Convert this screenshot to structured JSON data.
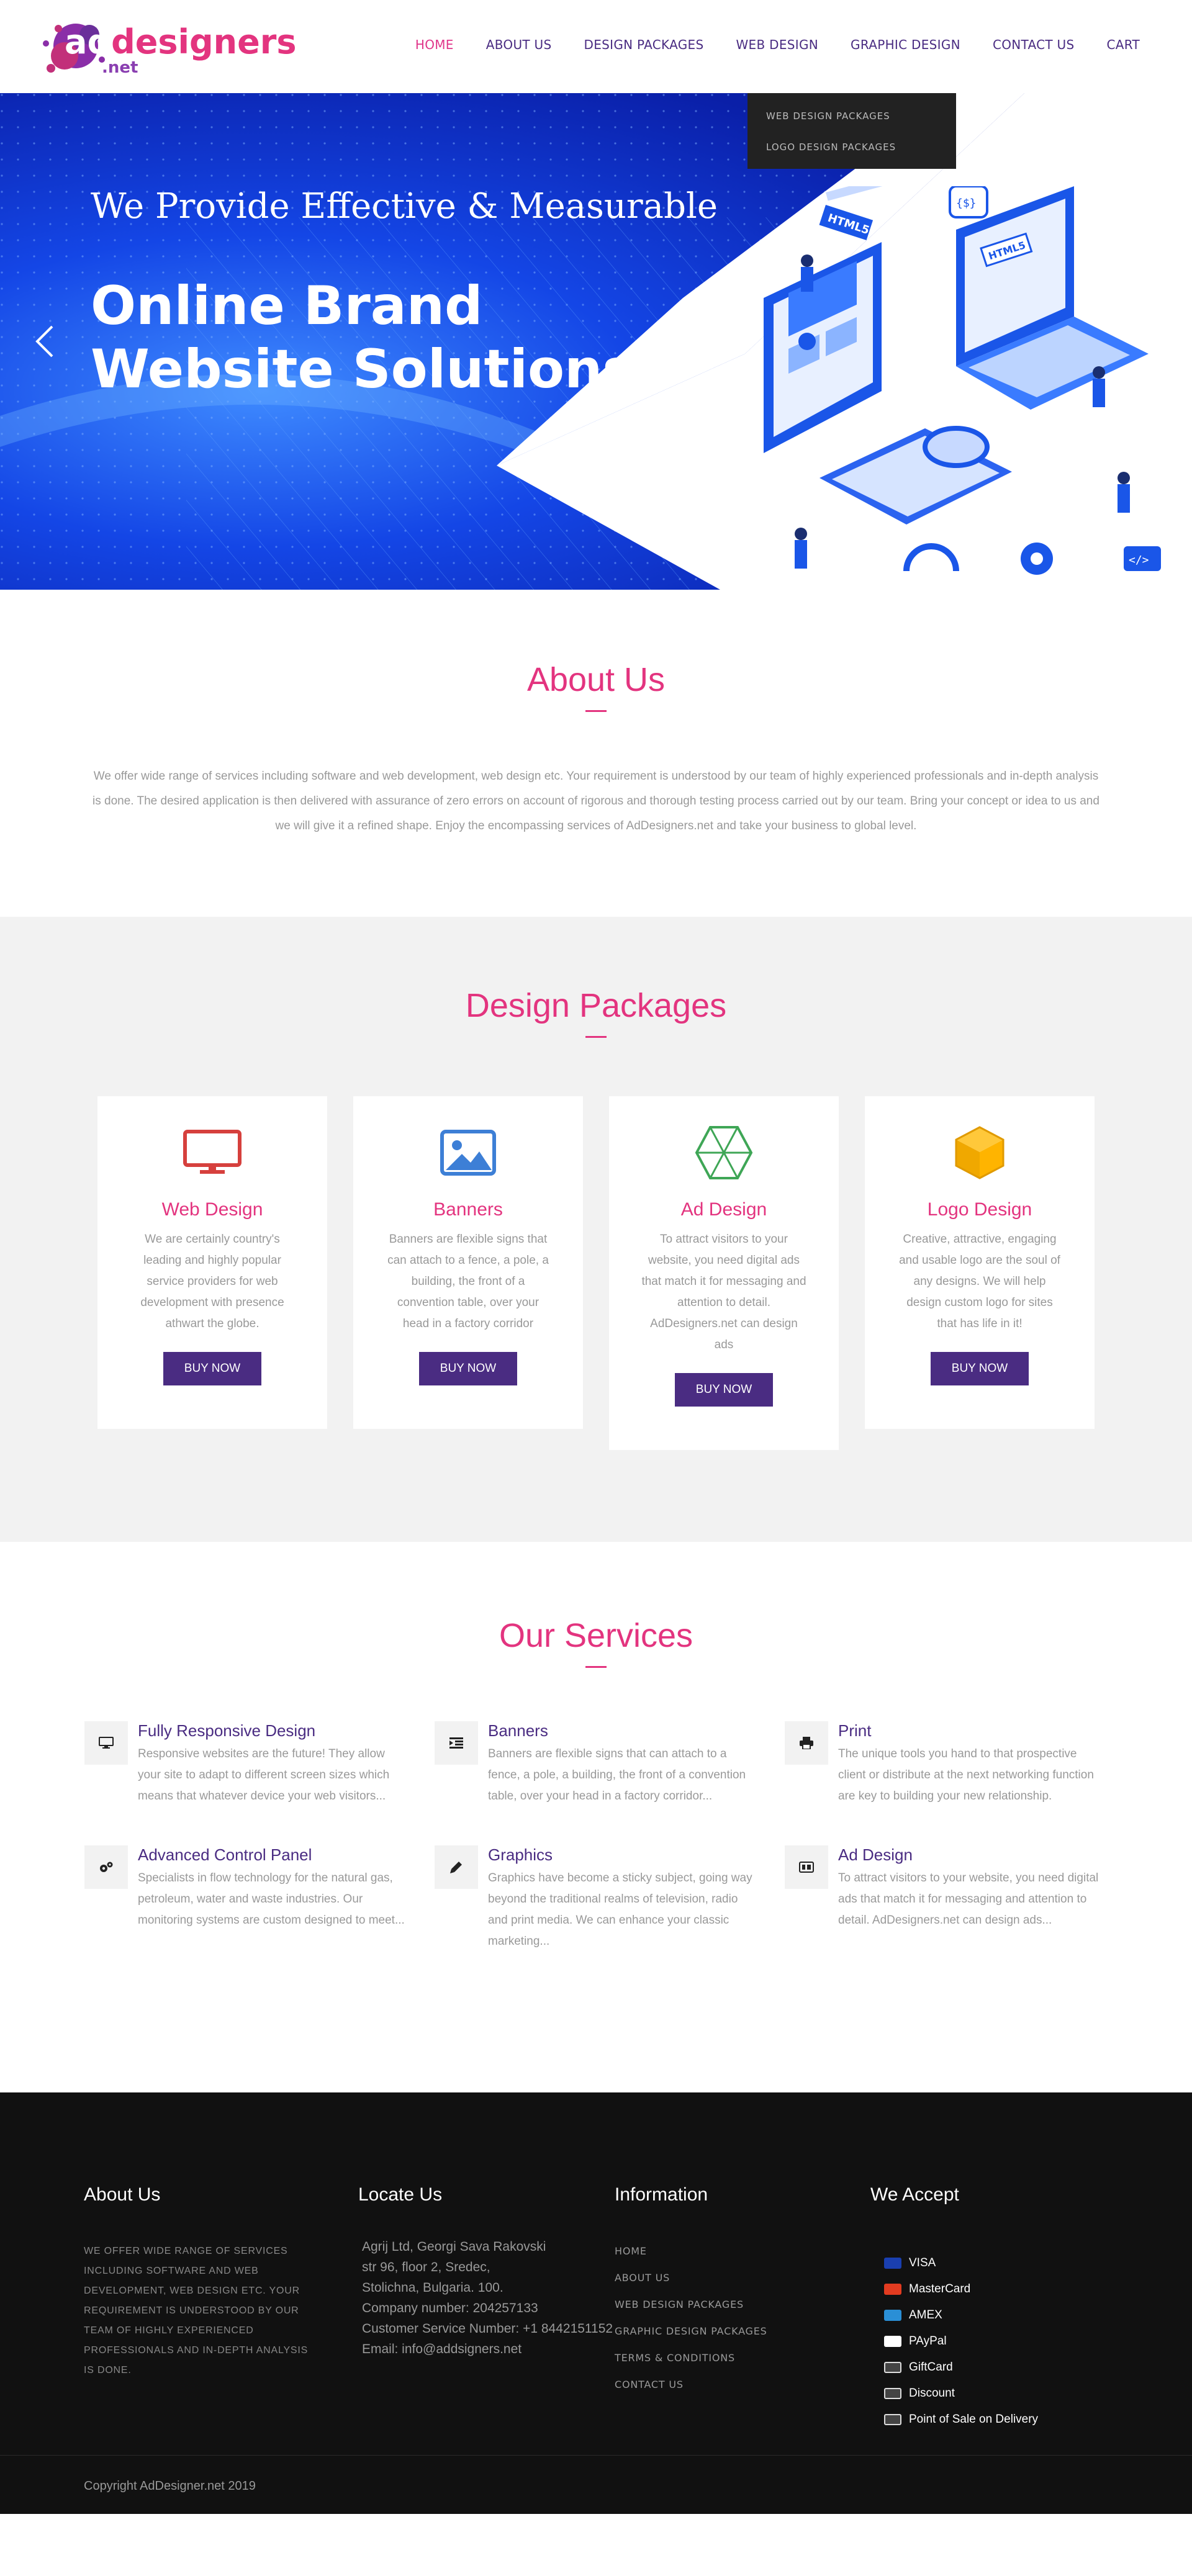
{
  "brand": {
    "logo_ad": "ad",
    "logo_name": "designers",
    "logo_tld": ".net"
  },
  "nav": {
    "items": [
      "HOME",
      "ABOUT US",
      "DESIGN PACKAGES",
      "WEB DESIGN",
      "GRAPHIC DESIGN",
      "CONTACT US",
      "CART"
    ],
    "active": "HOME",
    "active_color": "#e0368a",
    "color": "#4a2c82"
  },
  "web_design_dropdown": {
    "items": [
      "WEB DESIGN PACKAGES",
      "LOGO DESIGN PACKAGES"
    ]
  },
  "hero": {
    "subtitle": "We Provide Effective & Measurable",
    "title_line1": "Online Brand",
    "title_line2": "Website Solutions",
    "illustration_label_1": "{$}",
    "illustration_label_2": "HTML5",
    "illustration_label_3": "HTML5",
    "illustration_label_4": "</>",
    "prev_icon": "chevron-left-icon"
  },
  "about": {
    "title": "About Us",
    "text": "We offer wide range of services including software and web development, web design etc. Your requirement is understood by our team of highly experienced professionals and in-depth analysis is done. The desired application is then delivered with assurance of zero errors on account of rigorous and thorough testing process carried out by our team. Bring your concept or idea to us and we will give it a refined shape. Enjoy the encompassing services of AdDesigners.net and take your business to global level."
  },
  "packages": {
    "title": "Design Packages",
    "cards": [
      {
        "title": "Web Design",
        "text": "We are certainly country's leading and highly popular service providers for web development with presence athwart the globe.",
        "button": "BUY NOW",
        "icon": "monitor-icon"
      },
      {
        "title": "Banners",
        "text": "Banners are flexible signs that can attach to a fence, a pole, a building, the front of a convention table, over your head in a factory corridor",
        "button": "BUY NOW",
        "icon": "image-icon"
      },
      {
        "title": "Ad Design",
        "text": "To attract visitors to your website, you need digital ads that match it for messaging and attention to detail. AdDesigners.net can design ads",
        "button": "BUY NOW",
        "icon": "hexagon-mesh-icon"
      },
      {
        "title": "Logo Design",
        "text": "Creative, attractive, engaging and usable logo are the soul of any designs. We will help design custom logo for sites that has life in it!",
        "button": "BUY NOW",
        "icon": "cube-icon"
      }
    ]
  },
  "services": {
    "title": "Our Services",
    "items": [
      {
        "title": "Fully Responsive Design",
        "text": "Responsive websites are the future! They allow your site to adapt to different screen sizes which means that whatever device your web visitors...",
        "icon": "desktop-icon"
      },
      {
        "title": "Banners",
        "text": "Banners are flexible signs that can attach to a fence, a pole, a building, the front of a convention table, over your head in a factory corridor...",
        "icon": "indent-icon"
      },
      {
        "title": "Print",
        "text": "The unique tools you hand to that prospective client or distribute at the next networking function are key to building your new relationship.",
        "icon": "printer-icon"
      },
      {
        "title": "Advanced Control Panel",
        "text": "Specialists in flow technology for the natural gas, petroleum, water and waste industries. Our monitoring systems are custom designed to meet...",
        "icon": "gears-icon"
      },
      {
        "title": "Graphics",
        "text": "Graphics have become a sticky subject, going way beyond the traditional realms of television, radio and print media. We can enhance your classic marketing...",
        "icon": "pencil-icon"
      },
      {
        "title": "Ad Design",
        "text": "To attract visitors to your website, you need digital ads that match it for messaging and attention to detail. AdDesigners.net can design ads...",
        "icon": "ad-icon"
      }
    ]
  },
  "footer": {
    "about_title": "About Us",
    "about_text": "WE OFFER WIDE RANGE OF SERVICES INCLUDING SOFTWARE AND WEB DEVELOPMENT, WEB DESIGN ETC. YOUR REQUIREMENT IS UNDERSTOOD BY OUR TEAM OF HIGHLY EXPERIENCED PROFESSIONALS AND IN-DEPTH ANALYSIS IS DONE.",
    "locate_title": "Locate Us",
    "locate_lines": [
      "Agrij Ltd, Georgi Sava Rakovski",
      "str 96, floor 2, Sredec,",
      "Stolichna, Bulgaria. 100.",
      "Company number: 204257133",
      "Customer Service Number: +1 8442151152",
      "Email: info@addsigners.net"
    ],
    "info_title": "Information",
    "info_links": [
      "HOME",
      "ABOUT US",
      "WEB DESIGN PACKAGES",
      "GRAPHIC DESIGN PACKAGES",
      "TERMS & CONDITIONS",
      "CONTACT US"
    ],
    "accept_title": "We Accept",
    "payments": [
      {
        "label": "VISA",
        "color": "#1a3fb0"
      },
      {
        "label": "MasterCard",
        "color": "#e23b20"
      },
      {
        "label": "AMEX",
        "color": "#2a8fd6"
      },
      {
        "label": "PAyPal",
        "color": "#ffffff"
      },
      {
        "label": "GiftCard",
        "color": "#444444"
      },
      {
        "label": "Discount",
        "color": "#444444"
      },
      {
        "label": "Point of Sale on Delivery",
        "color": "#444444"
      }
    ],
    "copyright": "Copyright AdDesigner.net 2019"
  }
}
